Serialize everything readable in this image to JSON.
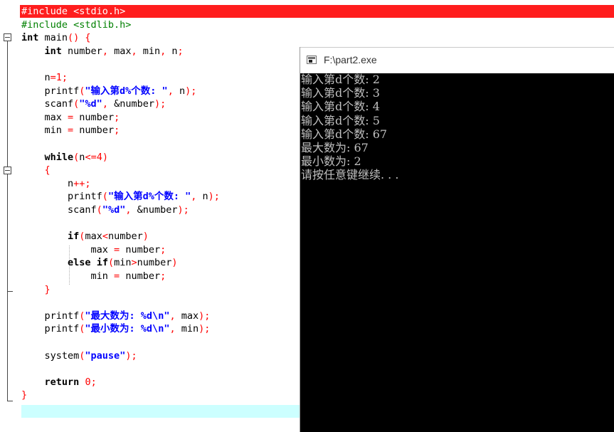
{
  "editor": {
    "lines": [
      {
        "parts": [
          {
            "t": "#include <stdio.h>",
            "c": "pp"
          }
        ],
        "highlight": "error"
      },
      {
        "parts": [
          {
            "t": "#include <stdlib.h>",
            "c": "pp"
          }
        ]
      },
      {
        "parts": [
          {
            "t": "int",
            "c": "kw2"
          },
          {
            "t": " main",
            "c": "id"
          },
          {
            "t": "()",
            "c": "punc"
          },
          {
            "t": " {",
            "c": "punc"
          }
        ]
      },
      {
        "parts": [
          {
            "t": "    ",
            "c": "id"
          },
          {
            "t": "int",
            "c": "kw2"
          },
          {
            "t": " number",
            "c": "id"
          },
          {
            "t": ",",
            "c": "punc"
          },
          {
            "t": " max",
            "c": "id"
          },
          {
            "t": ",",
            "c": "punc"
          },
          {
            "t": " min",
            "c": "id"
          },
          {
            "t": ",",
            "c": "punc"
          },
          {
            "t": " n",
            "c": "id"
          },
          {
            "t": ";",
            "c": "punc"
          }
        ]
      },
      {
        "parts": [
          {
            "t": "",
            "c": "id"
          }
        ]
      },
      {
        "parts": [
          {
            "t": "    n",
            "c": "id"
          },
          {
            "t": "=",
            "c": "punc"
          },
          {
            "t": "1",
            "c": "num"
          },
          {
            "t": ";",
            "c": "punc"
          }
        ]
      },
      {
        "parts": [
          {
            "t": "    printf",
            "c": "id"
          },
          {
            "t": "(",
            "c": "punc"
          },
          {
            "t": "\"输入第d%个数: \"",
            "c": "str"
          },
          {
            "t": ",",
            "c": "punc"
          },
          {
            "t": " n",
            "c": "id"
          },
          {
            "t": ");",
            "c": "punc"
          }
        ]
      },
      {
        "parts": [
          {
            "t": "    scanf",
            "c": "id"
          },
          {
            "t": "(",
            "c": "punc"
          },
          {
            "t": "\"%d\"",
            "c": "str"
          },
          {
            "t": ",",
            "c": "punc"
          },
          {
            "t": " &number",
            "c": "id"
          },
          {
            "t": ");",
            "c": "punc"
          }
        ]
      },
      {
        "parts": [
          {
            "t": "    max ",
            "c": "id"
          },
          {
            "t": "=",
            "c": "punc"
          },
          {
            "t": " number",
            "c": "id"
          },
          {
            "t": ";",
            "c": "punc"
          }
        ]
      },
      {
        "parts": [
          {
            "t": "    min ",
            "c": "id"
          },
          {
            "t": "=",
            "c": "punc"
          },
          {
            "t": " number",
            "c": "id"
          },
          {
            "t": ";",
            "c": "punc"
          }
        ]
      },
      {
        "parts": [
          {
            "t": "",
            "c": "id"
          }
        ]
      },
      {
        "parts": [
          {
            "t": "    ",
            "c": "id"
          },
          {
            "t": "while",
            "c": "kw2"
          },
          {
            "t": "(",
            "c": "punc"
          },
          {
            "t": "n",
            "c": "id"
          },
          {
            "t": "<=",
            "c": "punc"
          },
          {
            "t": "4",
            "c": "num"
          },
          {
            "t": ")",
            "c": "punc"
          }
        ]
      },
      {
        "parts": [
          {
            "t": "    {",
            "c": "punc"
          }
        ]
      },
      {
        "parts": [
          {
            "t": "        n",
            "c": "id"
          },
          {
            "t": "++;",
            "c": "punc"
          }
        ]
      },
      {
        "parts": [
          {
            "t": "        printf",
            "c": "id"
          },
          {
            "t": "(",
            "c": "punc"
          },
          {
            "t": "\"输入第d%个数: \"",
            "c": "str"
          },
          {
            "t": ",",
            "c": "punc"
          },
          {
            "t": " n",
            "c": "id"
          },
          {
            "t": ");",
            "c": "punc"
          }
        ]
      },
      {
        "parts": [
          {
            "t": "        scanf",
            "c": "id"
          },
          {
            "t": "(",
            "c": "punc"
          },
          {
            "t": "\"%d\"",
            "c": "str"
          },
          {
            "t": ",",
            "c": "punc"
          },
          {
            "t": " &number",
            "c": "id"
          },
          {
            "t": ");",
            "c": "punc"
          }
        ]
      },
      {
        "parts": [
          {
            "t": "",
            "c": "id"
          }
        ]
      },
      {
        "parts": [
          {
            "t": "        ",
            "c": "id"
          },
          {
            "t": "if",
            "c": "kw2"
          },
          {
            "t": "(",
            "c": "punc"
          },
          {
            "t": "max",
            "c": "id"
          },
          {
            "t": "<",
            "c": "punc"
          },
          {
            "t": "number",
            "c": "id"
          },
          {
            "t": ")",
            "c": "punc"
          }
        ]
      },
      {
        "parts": [
          {
            "t": "            max ",
            "c": "id"
          },
          {
            "t": "=",
            "c": "punc"
          },
          {
            "t": " number",
            "c": "id"
          },
          {
            "t": ";",
            "c": "punc"
          }
        ]
      },
      {
        "parts": [
          {
            "t": "        ",
            "c": "id"
          },
          {
            "t": "else",
            "c": "kw2"
          },
          {
            "t": " ",
            "c": "id"
          },
          {
            "t": "if",
            "c": "kw2"
          },
          {
            "t": "(",
            "c": "punc"
          },
          {
            "t": "min",
            "c": "id"
          },
          {
            "t": ">",
            "c": "punc"
          },
          {
            "t": "number",
            "c": "id"
          },
          {
            "t": ")",
            "c": "punc"
          }
        ]
      },
      {
        "parts": [
          {
            "t": "            min ",
            "c": "id"
          },
          {
            "t": "=",
            "c": "punc"
          },
          {
            "t": " number",
            "c": "id"
          },
          {
            "t": ";",
            "c": "punc"
          }
        ]
      },
      {
        "parts": [
          {
            "t": "    }",
            "c": "punc"
          }
        ]
      },
      {
        "parts": [
          {
            "t": "",
            "c": "id"
          }
        ]
      },
      {
        "parts": [
          {
            "t": "    printf",
            "c": "id"
          },
          {
            "t": "(",
            "c": "punc"
          },
          {
            "t": "\"最大数为: %d\\n\"",
            "c": "str"
          },
          {
            "t": ",",
            "c": "punc"
          },
          {
            "t": " max",
            "c": "id"
          },
          {
            "t": ");",
            "c": "punc"
          }
        ]
      },
      {
        "parts": [
          {
            "t": "    printf",
            "c": "id"
          },
          {
            "t": "(",
            "c": "punc"
          },
          {
            "t": "\"最小数为: %d\\n\"",
            "c": "str"
          },
          {
            "t": ",",
            "c": "punc"
          },
          {
            "t": " min",
            "c": "id"
          },
          {
            "t": ");",
            "c": "punc"
          }
        ]
      },
      {
        "parts": [
          {
            "t": "",
            "c": "id"
          }
        ]
      },
      {
        "parts": [
          {
            "t": "    system",
            "c": "id"
          },
          {
            "t": "(",
            "c": "punc"
          },
          {
            "t": "\"pause\"",
            "c": "str"
          },
          {
            "t": ");",
            "c": "punc"
          }
        ]
      },
      {
        "parts": [
          {
            "t": "",
            "c": "id"
          }
        ]
      },
      {
        "parts": [
          {
            "t": "    ",
            "c": "id"
          },
          {
            "t": "return",
            "c": "kw2"
          },
          {
            "t": " ",
            "c": "id"
          },
          {
            "t": "0",
            "c": "num"
          },
          {
            "t": ";",
            "c": "punc"
          }
        ]
      },
      {
        "parts": [
          {
            "t": "}",
            "c": "punc"
          }
        ]
      }
    ]
  },
  "console": {
    "title": "F:\\part2.exe",
    "icon": "console-window-icon",
    "lines": [
      "输入第d个数: 2",
      "输入第d个数: 3",
      "输入第d个数: 4",
      "输入第d个数: 5",
      "输入第d个数: 67",
      "最大数为: 67",
      "最小数为: 2",
      "请按任意键继续. . ."
    ]
  }
}
